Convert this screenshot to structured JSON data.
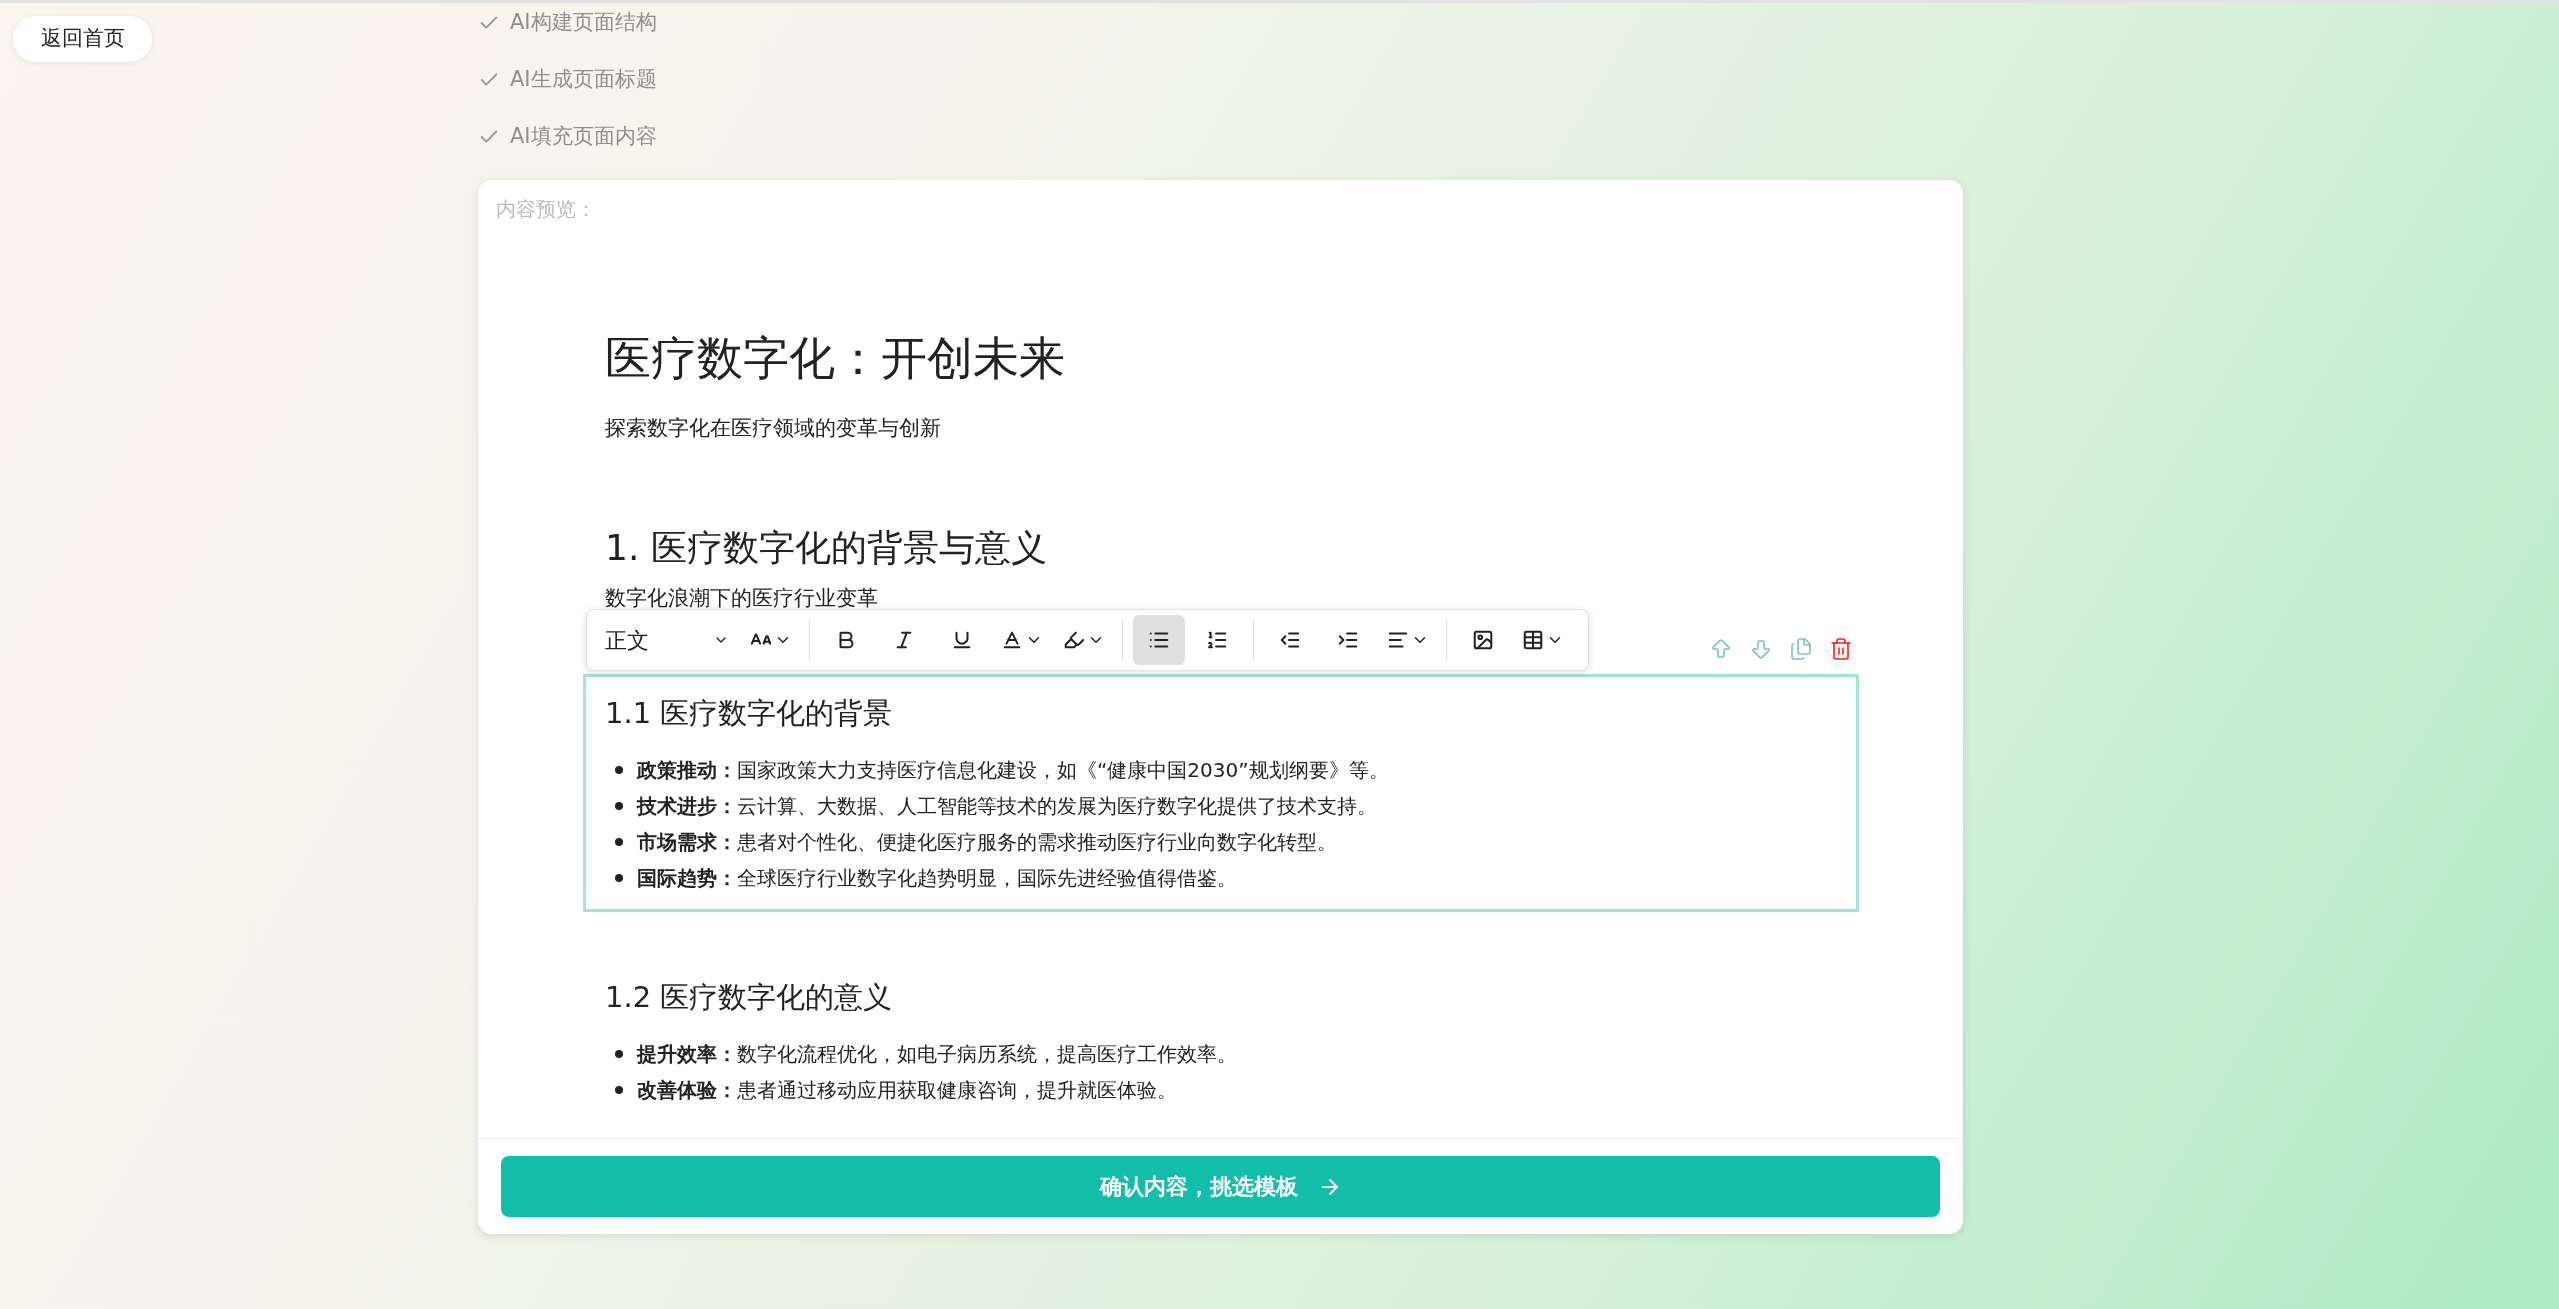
{
  "back_button": "返回首页",
  "steps": [
    {
      "label": "AI构建页面结构",
      "done": true
    },
    {
      "label": "AI生成页面标题",
      "done": true
    },
    {
      "label": "AI填充页面内容",
      "done": true
    }
  ],
  "preview": {
    "label": "内容预览：",
    "title": "医疗数字化：开创未来",
    "subtitle": "探索数字化在医疗领域的变革与创新",
    "sections": [
      {
        "kind": "h2",
        "heading": "1. 医疗数字化的背景与意义",
        "paragraph": "数字化浪潮下的医疗行业变革",
        "selected": false
      },
      {
        "kind": "h3",
        "heading": "1.1 医疗数字化的背景",
        "selected": true,
        "items": [
          "**政策推动：**国家政策大力支持医疗信息化建设，如《“健康中国2030”规划纲要》等。",
          "**技术进步：**云计算、大数据、人工智能等技术的发展为医疗数字化提供了技术支持。",
          "**市场需求：**患者对个性化、便捷化医疗服务的需求推动医疗行业向数字化转型。",
          "**国际趋势：**全球医疗行业数字化趋势明显，国际先进经验值得借鉴。"
        ]
      },
      {
        "kind": "h3",
        "heading": "1.2 医疗数字化的意义",
        "selected": false,
        "items": [
          "**提升效率：**数字化流程优化，如电子病历系统，提高医疗工作效率。",
          "**改善体验：**患者通过移动应用获取健康咨询，提升就医体验。"
        ]
      }
    ]
  },
  "toolbar": {
    "style": "正文",
    "buttons": [
      {
        "kind": "font-size",
        "selected": false
      },
      {
        "kind": "divider"
      },
      {
        "kind": "bold",
        "selected": false
      },
      {
        "kind": "italic",
        "selected": false
      },
      {
        "kind": "underline",
        "selected": false
      },
      {
        "kind": "font-color",
        "selected": false
      },
      {
        "kind": "highlight",
        "selected": false
      },
      {
        "kind": "divider"
      },
      {
        "kind": "bullet-list",
        "selected": true
      },
      {
        "kind": "ordered-list",
        "selected": false
      },
      {
        "kind": "divider"
      },
      {
        "kind": "outdent",
        "selected": false
      },
      {
        "kind": "indent",
        "selected": false
      },
      {
        "kind": "align",
        "selected": false
      },
      {
        "kind": "divider"
      },
      {
        "kind": "image",
        "selected": false
      },
      {
        "kind": "table",
        "selected": false
      }
    ]
  },
  "block_actions": [
    {
      "kind": "move-up"
    },
    {
      "kind": "move-down"
    },
    {
      "kind": "copy"
    },
    {
      "kind": "delete"
    }
  ],
  "confirm_button": "确认内容，挑选模板"
}
